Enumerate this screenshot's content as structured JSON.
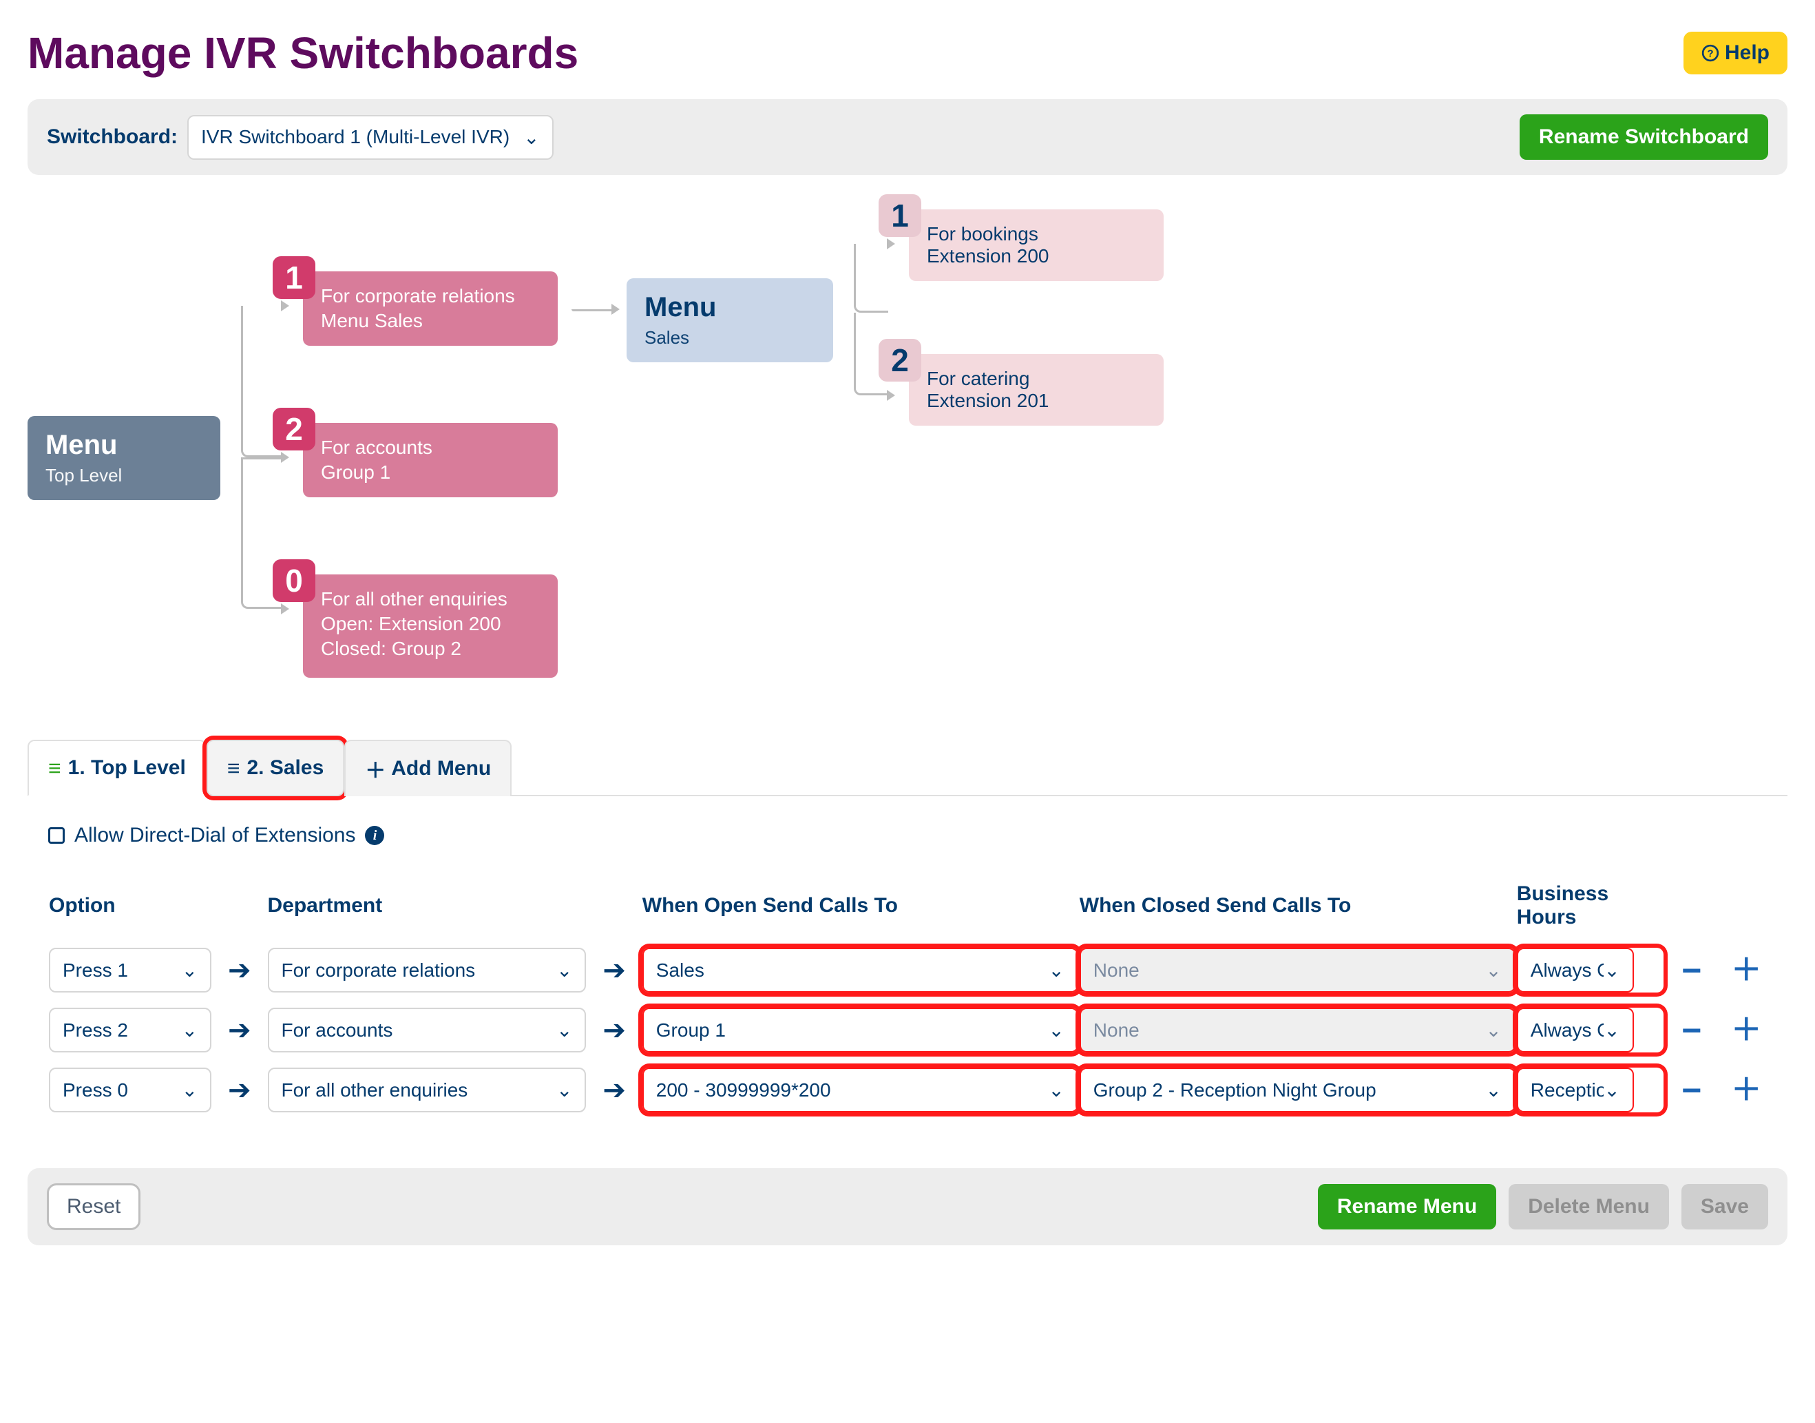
{
  "header": {
    "title": "Manage IVR Switchboards",
    "help": "Help"
  },
  "switchboard_bar": {
    "label": "Switchboard:",
    "selected": "IVR Switchboard 1 (Multi-Level IVR)",
    "rename": "Rename Switchboard"
  },
  "diagram": {
    "root": {
      "title": "Menu",
      "subtitle": "Top Level"
    },
    "level1": [
      {
        "key": "1",
        "l1": "For corporate relations",
        "l2": "Menu Sales"
      },
      {
        "key": "2",
        "l1": "For accounts",
        "l2": "Group 1"
      },
      {
        "key": "0",
        "l1": "For all other enquiries",
        "l2": "Open: Extension 200",
        "l3": "Closed: Group 2"
      }
    ],
    "sales_menu": {
      "title": "Menu",
      "subtitle": "Sales"
    },
    "level2": [
      {
        "key": "1",
        "l1": "For bookings",
        "l2": "Extension 200"
      },
      {
        "key": "2",
        "l1": "For catering",
        "l2": "Extension 201"
      }
    ]
  },
  "tabs": {
    "t1": "1. Top Level",
    "t2": "2. Sales",
    "add": "Add Menu"
  },
  "body": {
    "direct_dial": "Allow Direct-Dial of Extensions",
    "headers": {
      "option": "Option",
      "dept": "Department",
      "open": "When Open Send Calls To",
      "closed": "When Closed Send Calls To",
      "hours": "Business Hours"
    },
    "rows": [
      {
        "option": "Press 1",
        "dept": "For corporate relations",
        "open": "Sales",
        "closed": "None",
        "closed_disabled": true,
        "hours": "Always Op"
      },
      {
        "option": "Press 2",
        "dept": "For accounts",
        "open": "Group 1",
        "closed": "None",
        "closed_disabled": true,
        "hours": "Always Op"
      },
      {
        "option": "Press 0",
        "dept": "For all other enquiries",
        "open": "200 - 30999999*200",
        "closed": "Group 2 - Reception Night Group",
        "closed_disabled": false,
        "hours": "Reception"
      }
    ]
  },
  "footer": {
    "reset": "Reset",
    "rename_menu": "Rename Menu",
    "delete_menu": "Delete Menu",
    "save": "Save"
  }
}
